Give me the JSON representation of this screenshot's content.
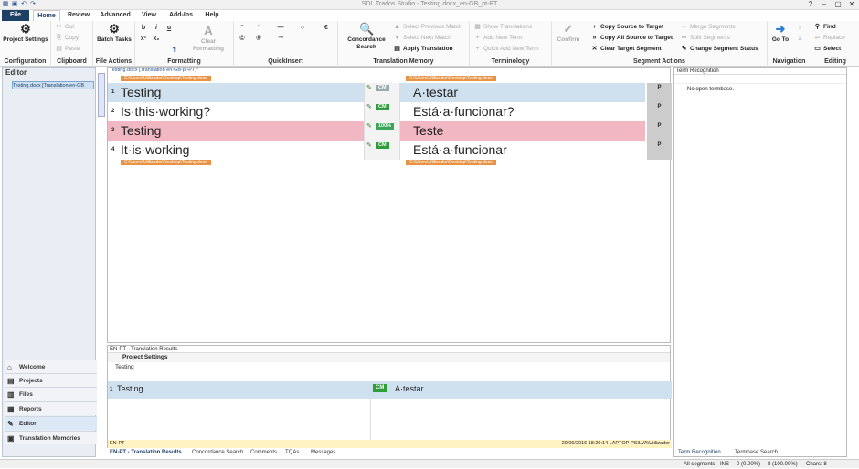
{
  "window": {
    "title": "SDL Trados Studio - Testing.docx_en-GB_pt-PT"
  },
  "tabs": [
    "File",
    "Home",
    "Review",
    "Advanced",
    "View",
    "Add-Ins",
    "Help"
  ],
  "ribbon": {
    "configuration": {
      "label": "Configuration",
      "project_settings": "Project Settings"
    },
    "clipboard": {
      "label": "Clipboard",
      "cut": "Cut",
      "copy": "Copy",
      "paste": "Paste"
    },
    "file_actions": {
      "label": "File Actions",
      "batch_tasks": "Batch Tasks"
    },
    "formatting": {
      "label": "Formatting",
      "bold": "b",
      "italic": "i",
      "underline": "u",
      "sup": "x²",
      "sub": "x₂",
      "clear": "Clear Formatting"
    },
    "quickinsert": {
      "label": "QuickInsert"
    },
    "translation_memory": {
      "label": "Translation Memory",
      "concordance": "Concordance Search",
      "prev_match": "Select Previous Match",
      "next_match": "Select Next Match",
      "apply": "Apply Translation"
    },
    "terminology": {
      "label": "Terminology",
      "show": "Show Translations",
      "add": "Add New Term",
      "quick_add": "Quick Add New Term"
    },
    "segment_actions": {
      "label": "Segment Actions",
      "confirm": "Confirm",
      "copy_source": "Copy Source to Target",
      "copy_all": "Copy All Source to Target",
      "clear_target": "Clear Target Segment",
      "merge": "Merge Segments",
      "split": "Split Segments",
      "change_status": "Change Segment Status"
    },
    "navigation": {
      "label": "Navigation",
      "goto": "Go To"
    },
    "editing": {
      "label": "Editing",
      "find": "Find",
      "replace": "Replace",
      "select": "Select"
    }
  },
  "left": {
    "title": "Editor",
    "doc": "Testing.docx [Translation en-GB",
    "nav": [
      "Welcome",
      "Projects",
      "Files",
      "Reports",
      "Editor",
      "Translation Memories"
    ]
  },
  "editor": {
    "src_header": "Testing.docx [Translation en-GB-pt-PT]*",
    "path": "C:\\Users\\Utilizador\\Desktop\\Testing.docx",
    "rows": [
      {
        "n": "1",
        "src": "Testing",
        "tgt": "A·testar",
        "badge": "CM",
        "pct": "",
        "p": "P",
        "color": "#cfe0ee"
      },
      {
        "n": "2",
        "src": "Is·this·working?",
        "tgt": "Está·a·funcionar?",
        "badge": "CM",
        "pct": "",
        "p": "P",
        "color": "#ffffff"
      },
      {
        "n": "3",
        "src": "Testing",
        "tgt": "Teste",
        "badge": "100%",
        "pct": "",
        "p": "P",
        "color": "#f1b7c2"
      },
      {
        "n": "4",
        "src": "It·is·working",
        "tgt": "Está·a·funcionar",
        "badge": "CM",
        "pct": "",
        "p": "P",
        "color": "#ffffff"
      }
    ]
  },
  "term": {
    "title": "Term Recognition",
    "msg": "No open termbase."
  },
  "results": {
    "title": "EN-PT - Translation Results",
    "settings": "Project Settings",
    "src": "Testing",
    "row_n": "1",
    "row_src": "Testing",
    "row_badge": "CM",
    "row_tgt": "A·testar",
    "lang": "EN-PT",
    "meta": "29/06/2016 18:20:14   LAPTOP-PSILVA\\Utilizador"
  },
  "bottom_tabs": [
    "EN-PT - Translation Results",
    "Concordance Search",
    "Comments",
    "TQAs",
    "Messages"
  ],
  "term_tabs": [
    "Term Recognition",
    "Termbase Search"
  ],
  "status": {
    "segments": "All segments",
    "ins": "INS",
    "s1": "0 (0.00%)",
    "s2": "8 (100.00%)",
    "chars": "Chars: 8"
  }
}
